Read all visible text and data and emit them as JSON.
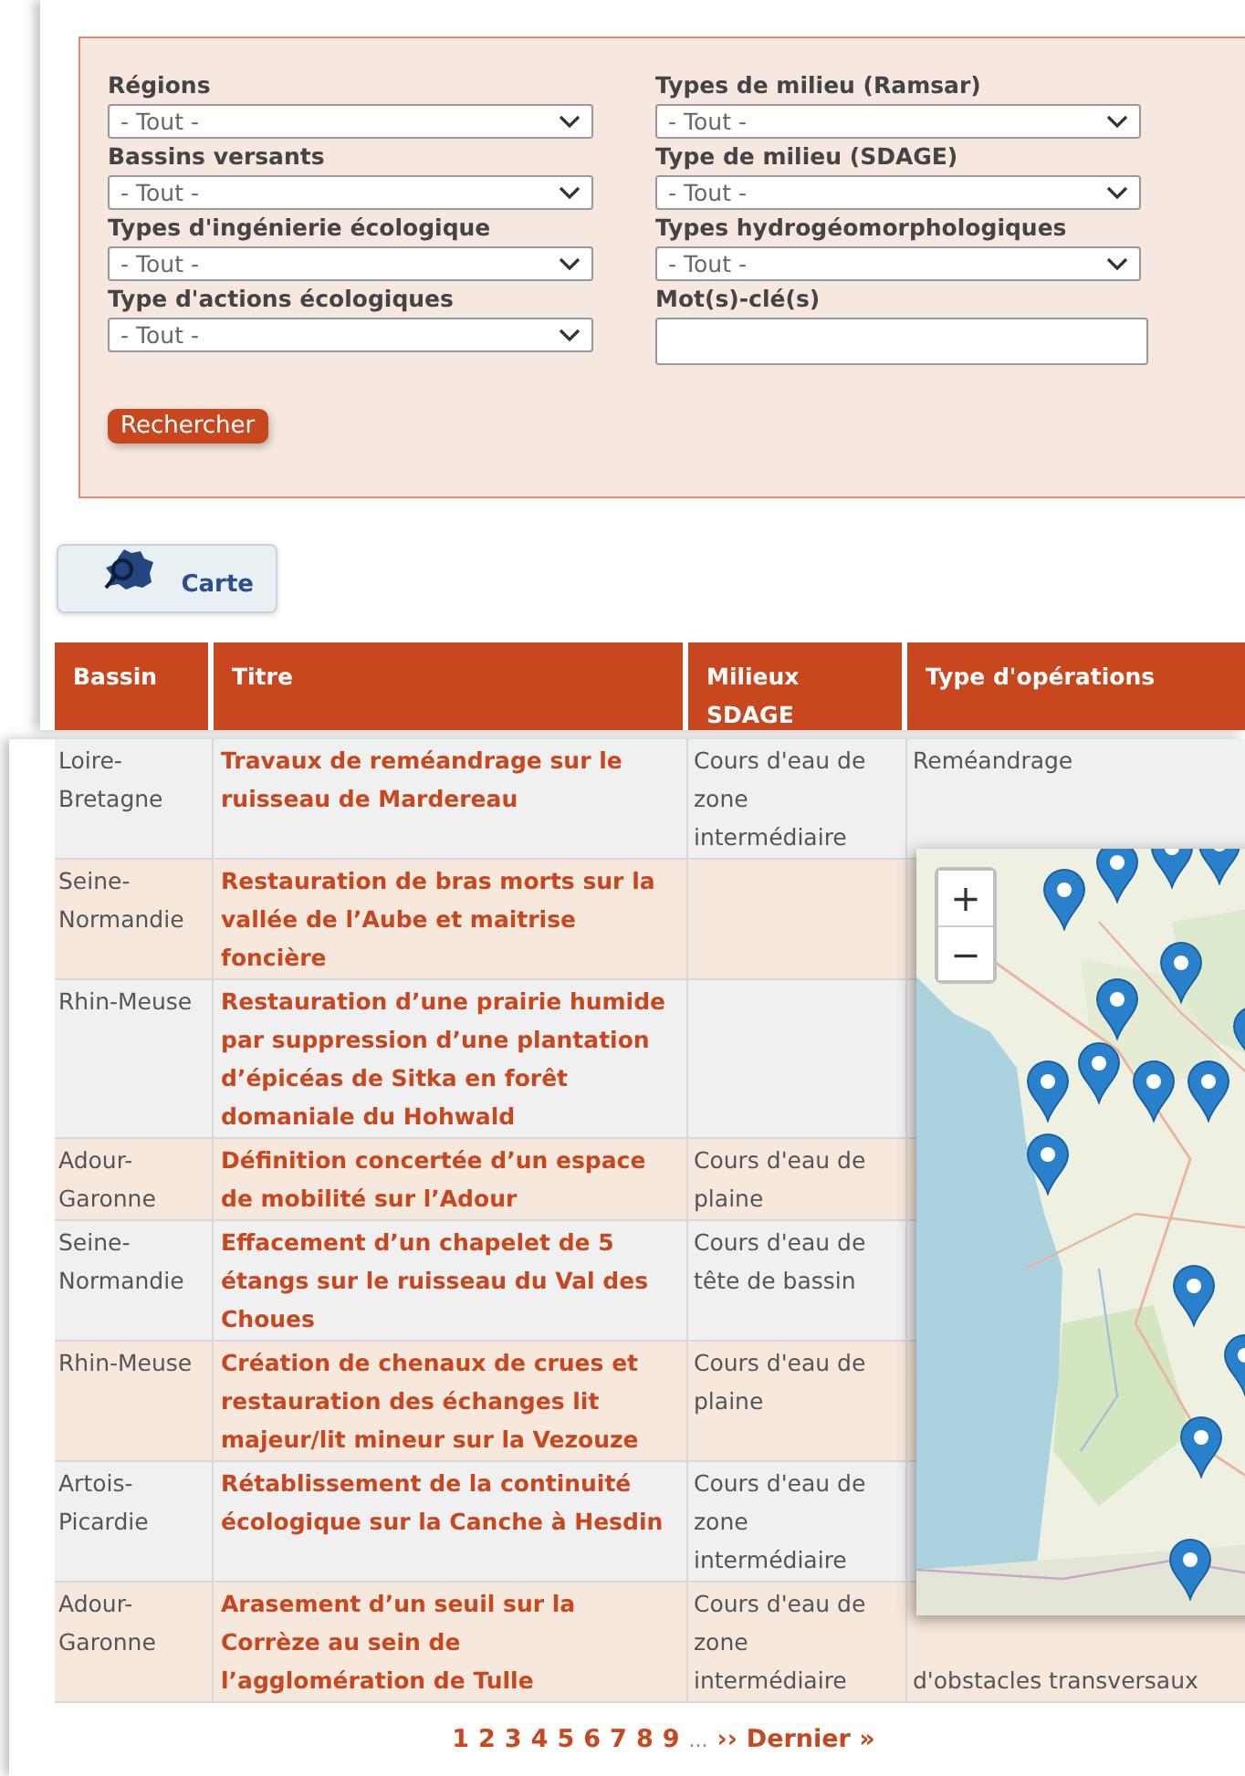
{
  "filters": [
    {
      "label": "Régions",
      "kind": "select",
      "value": "- Tout -"
    },
    {
      "label": "Types de milieu (Ramsar)",
      "kind": "select",
      "value": "- Tout -"
    },
    {
      "label": "Bassins versants",
      "kind": "select",
      "value": "- Tout -"
    },
    {
      "label": "Type de milieu (SDAGE)",
      "kind": "select",
      "value": "- Tout -"
    },
    {
      "label": "Types d'ingénierie écologique",
      "kind": "select",
      "value": "- Tout -"
    },
    {
      "label": "Types hydrogéomorphologiques",
      "kind": "select",
      "value": "- Tout -"
    },
    {
      "label": "Type d'actions écologiques",
      "kind": "select",
      "value": "- Tout -"
    },
    {
      "label": "Mot(s)-clé(s)",
      "kind": "input"
    }
  ],
  "search_button": "Rechercher",
  "map_button": "Carte",
  "table": {
    "columns": [
      "Bassin",
      "Titre",
      "Milieux SDAGE",
      "Type d'opérations"
    ],
    "rows": [
      {
        "bassin": "Loire-Bretagne",
        "titre": "Travaux de reméandrage sur le ruisseau de Mardereau",
        "milieux": "Cours d'eau de zone intermédiaire",
        "operations": "Reméandrage"
      },
      {
        "bassin": "Seine-Normandie",
        "titre": "Restauration de bras morts sur la vallée de l’Aube et maitrise foncière"
      },
      {
        "bassin": "Rhin-Meuse",
        "titre": "Restauration d’une prairie humide par suppression d’une plantation d’épicéas de Sitka en forêt domaniale du Hohwald"
      },
      {
        "bassin": "Adour-Garonne",
        "titre": "Définition concertée d’un espace de mobilité sur l’Adour",
        "milieux": "Cours d'eau de plaine"
      },
      {
        "bassin": "Seine-Normandie",
        "titre": "Effacement d’un chapelet de 5 étangs sur le ruisseau du Val des Choues",
        "milieux": "Cours d'eau de tête de bassin"
      },
      {
        "bassin": "Rhin-Meuse",
        "titre": "Création de chenaux de crues et restauration des échanges lit majeur/lit mineur sur la Vezouze",
        "milieux": "Cours d'eau de plaine"
      },
      {
        "bassin": "Artois-Picardie",
        "titre": "Rétablissement de la continuité écologique sur la Canche à Hesdin",
        "milieux": "Cours d'eau de zone intermédiaire"
      },
      {
        "bassin": "Adour-Garonne",
        "titre": "Arasement d’un seuil sur la Corrèze au sein de l’agglomération de Tulle",
        "milieux": "Cours d'eau de zone intermédiaire",
        "operations": "d'obstacles transversaux"
      }
    ]
  },
  "map": {
    "zoom_in": "+",
    "zoom_out": "−"
  },
  "pagination": {
    "pages": [
      "1",
      "2",
      "3",
      "4",
      "5",
      "6",
      "7",
      "8",
      "9"
    ],
    "ellipsis": "...",
    "next": "››",
    "last": "Dernier »"
  }
}
